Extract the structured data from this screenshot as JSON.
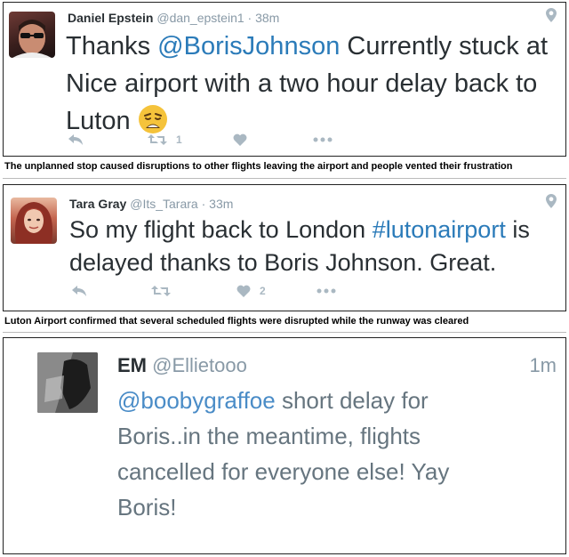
{
  "tweets": [
    {
      "fullname": "Daniel Epstein",
      "username": "@dan_epstein1",
      "separator": "·",
      "time": "38m",
      "text_pre": "Thanks ",
      "mention": "@BorisJohnson",
      "text_post": " Currently stuck at Nice airport with a two hour delay back to Luton",
      "emoji": "weary-face",
      "retweet_count": "1",
      "like_count": ""
    },
    {
      "fullname": "Tara Gray",
      "username": "@Its_Tarara",
      "separator": "·",
      "time": "33m",
      "text_pre": "So my flight back to London ",
      "hashtag": "#lutonairport",
      "text_post": " is delayed thanks to Boris Johnson. Great.",
      "retweet_count": "",
      "like_count": "2"
    },
    {
      "fullname": "EM",
      "username": "@Ellietooo",
      "time": "1m",
      "mention": "@boobygraffoe",
      "text_post": " short delay for Boris..in the meantime, flights cancelled for everyone else! Yay Boris!"
    }
  ],
  "captions": [
    "The unplanned stop caused disruptions to other flights leaving the airport and people vented their frustration",
    "Luton Airport confirmed that several scheduled flights were disrupted while the runway was cleared"
  ],
  "colors": {
    "link": "#2b7bb9",
    "muted": "#8899a6",
    "action": "#aab8c2",
    "text": "#292f33"
  }
}
